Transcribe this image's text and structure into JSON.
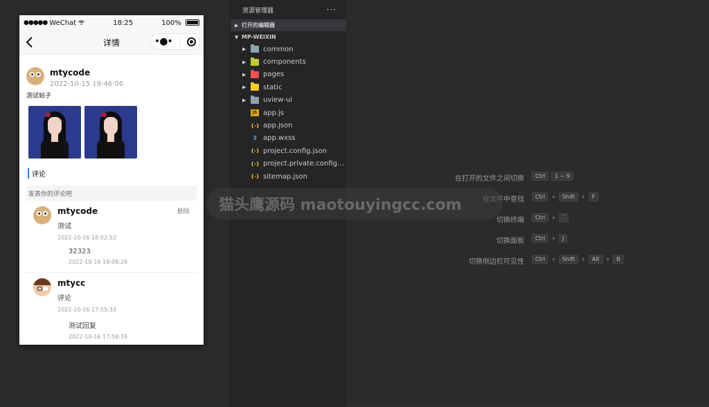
{
  "simulator": {
    "status_bar": {
      "carrier": "WeChat",
      "time": "18:25",
      "battery": "100%"
    },
    "nav": {
      "title": "详情"
    },
    "post": {
      "author": "mtycode",
      "time": "2022-10-15 19:46:06",
      "text": "测试帖子",
      "images": [
        "anime-girl-image",
        "anime-girl-image"
      ]
    },
    "comments_section": {
      "title": "评论",
      "input_placeholder": "发表你的评论吧",
      "comments": [
        {
          "author": "mtycode",
          "text": "测试",
          "time": "2022-10-16 18:02:52",
          "delete_label": "删除",
          "reply": {
            "text": "32323",
            "time": "2022-10-16 18:08:28"
          }
        },
        {
          "author": "mtycc",
          "text": "评论",
          "time": "2022-10-16 17:55:33",
          "reply": {
            "text": "测试回复",
            "time": "2022-10-16 17:59:18"
          }
        }
      ]
    }
  },
  "explorer": {
    "title": "资源管理器",
    "more": "···",
    "open_editors": "打开的编辑器",
    "project": "MP-WEIXIN",
    "items": [
      {
        "label": "common",
        "type": "folder",
        "color": "#90a4ae"
      },
      {
        "label": "components",
        "type": "folder",
        "color": "#c0ca33"
      },
      {
        "label": "pages",
        "type": "folder",
        "color": "#ef5350"
      },
      {
        "label": "static",
        "type": "folder",
        "color": "#ffca28"
      },
      {
        "label": "uview-ui",
        "type": "folder",
        "color": "#90a4ae"
      },
      {
        "label": "app.js",
        "type": "js"
      },
      {
        "label": "app.json",
        "type": "json"
      },
      {
        "label": "app.wxss",
        "type": "css"
      },
      {
        "label": "project.config.json",
        "type": "json"
      },
      {
        "label": "project.private.config.js...",
        "type": "json"
      },
      {
        "label": "sitemap.json",
        "type": "json"
      }
    ]
  },
  "shortcuts": [
    {
      "label": "在打开的文件之间切换",
      "keys": [
        "Ctrl",
        "1 ~ 9"
      ],
      "separator": ""
    },
    {
      "label": "在文件中查找",
      "keys": [
        "Ctrl",
        "Shift",
        "F"
      ],
      "separator": "+"
    },
    {
      "label": "切换终端",
      "keys": [
        "Ctrl",
        "`"
      ],
      "separator": "+"
    },
    {
      "label": "切换面板",
      "keys": [
        "Ctrl",
        "J"
      ],
      "separator": "+"
    },
    {
      "label": "切换侧边栏可见性",
      "keys": [
        "Ctrl",
        "Shift",
        "Alt",
        "B"
      ],
      "separator": "+"
    }
  ],
  "watermark": "猫头鹰源码 maotouyingcc.com"
}
